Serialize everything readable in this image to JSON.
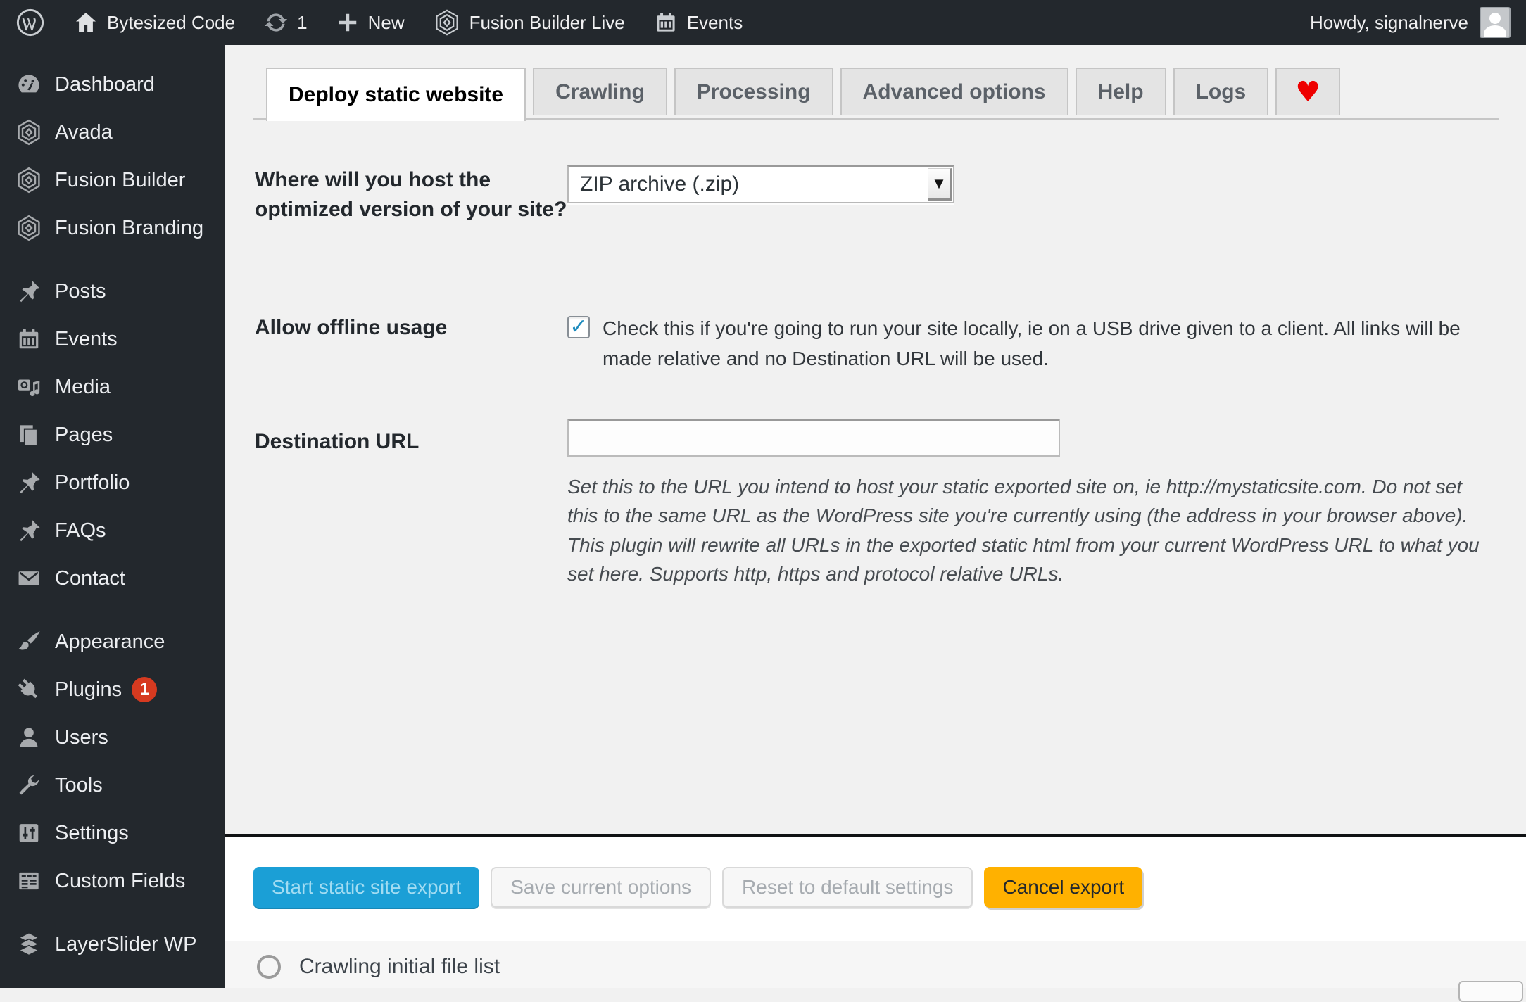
{
  "admin_bar": {
    "site_name": "Bytesized Code",
    "update_count": "1",
    "new_label": "New",
    "builder_label": "Fusion Builder Live",
    "events_label": "Events",
    "howdy": "Howdy, signalnerve"
  },
  "sidebar": {
    "items": [
      {
        "label": "Dashboard"
      },
      {
        "label": "Avada"
      },
      {
        "label": "Fusion Builder"
      },
      {
        "label": "Fusion Branding"
      },
      {
        "label": "Posts"
      },
      {
        "label": "Events"
      },
      {
        "label": "Media"
      },
      {
        "label": "Pages"
      },
      {
        "label": "Portfolio"
      },
      {
        "label": "FAQs"
      },
      {
        "label": "Contact"
      },
      {
        "label": "Appearance"
      },
      {
        "label": "Plugins",
        "badge": "1"
      },
      {
        "label": "Users"
      },
      {
        "label": "Tools"
      },
      {
        "label": "Settings"
      },
      {
        "label": "Custom Fields"
      },
      {
        "label": "LayerSlider WP"
      }
    ]
  },
  "tabs": {
    "items": [
      {
        "label": "Deploy static website",
        "active": true
      },
      {
        "label": "Crawling"
      },
      {
        "label": "Processing"
      },
      {
        "label": "Advanced options"
      },
      {
        "label": "Help"
      },
      {
        "label": "Logs"
      }
    ],
    "heart_glyph": "♥"
  },
  "form": {
    "host": {
      "label": "Where will you host the optimized version of your site?",
      "selected": "ZIP archive (.zip)",
      "dropdown_glyph": "▼"
    },
    "offline": {
      "label": "Allow offline usage",
      "checked": true,
      "check_glyph": "✓",
      "text": "Check this if you're going to run your site locally, ie on a USB drive given to a client. All links will be made relative and no Destination URL will be used."
    },
    "destination": {
      "label": "Destination URL",
      "value": "",
      "description": "Set this to the URL you intend to host your static exported site on, ie http://mystaticsite.com. Do not set this to the same URL as the WordPress site you're currently using (the address in your browser above). This plugin will rewrite all URLs in the exported static html from your current WordPress URL to what you set here. Supports http, https and protocol relative URLs."
    }
  },
  "actions": {
    "start": "Start static site export",
    "save": "Save current options",
    "reset": "Reset to default settings",
    "cancel": "Cancel export"
  },
  "status": {
    "current": "Crawling initial file list"
  },
  "colors": {
    "accent_blue": "#1b9fd6",
    "cancel_orange": "#ffb100",
    "badge_red": "#d63a20",
    "heart_red": "#ee0000",
    "check_blue": "#1e8cbe",
    "chrome_dark": "#23282d"
  }
}
